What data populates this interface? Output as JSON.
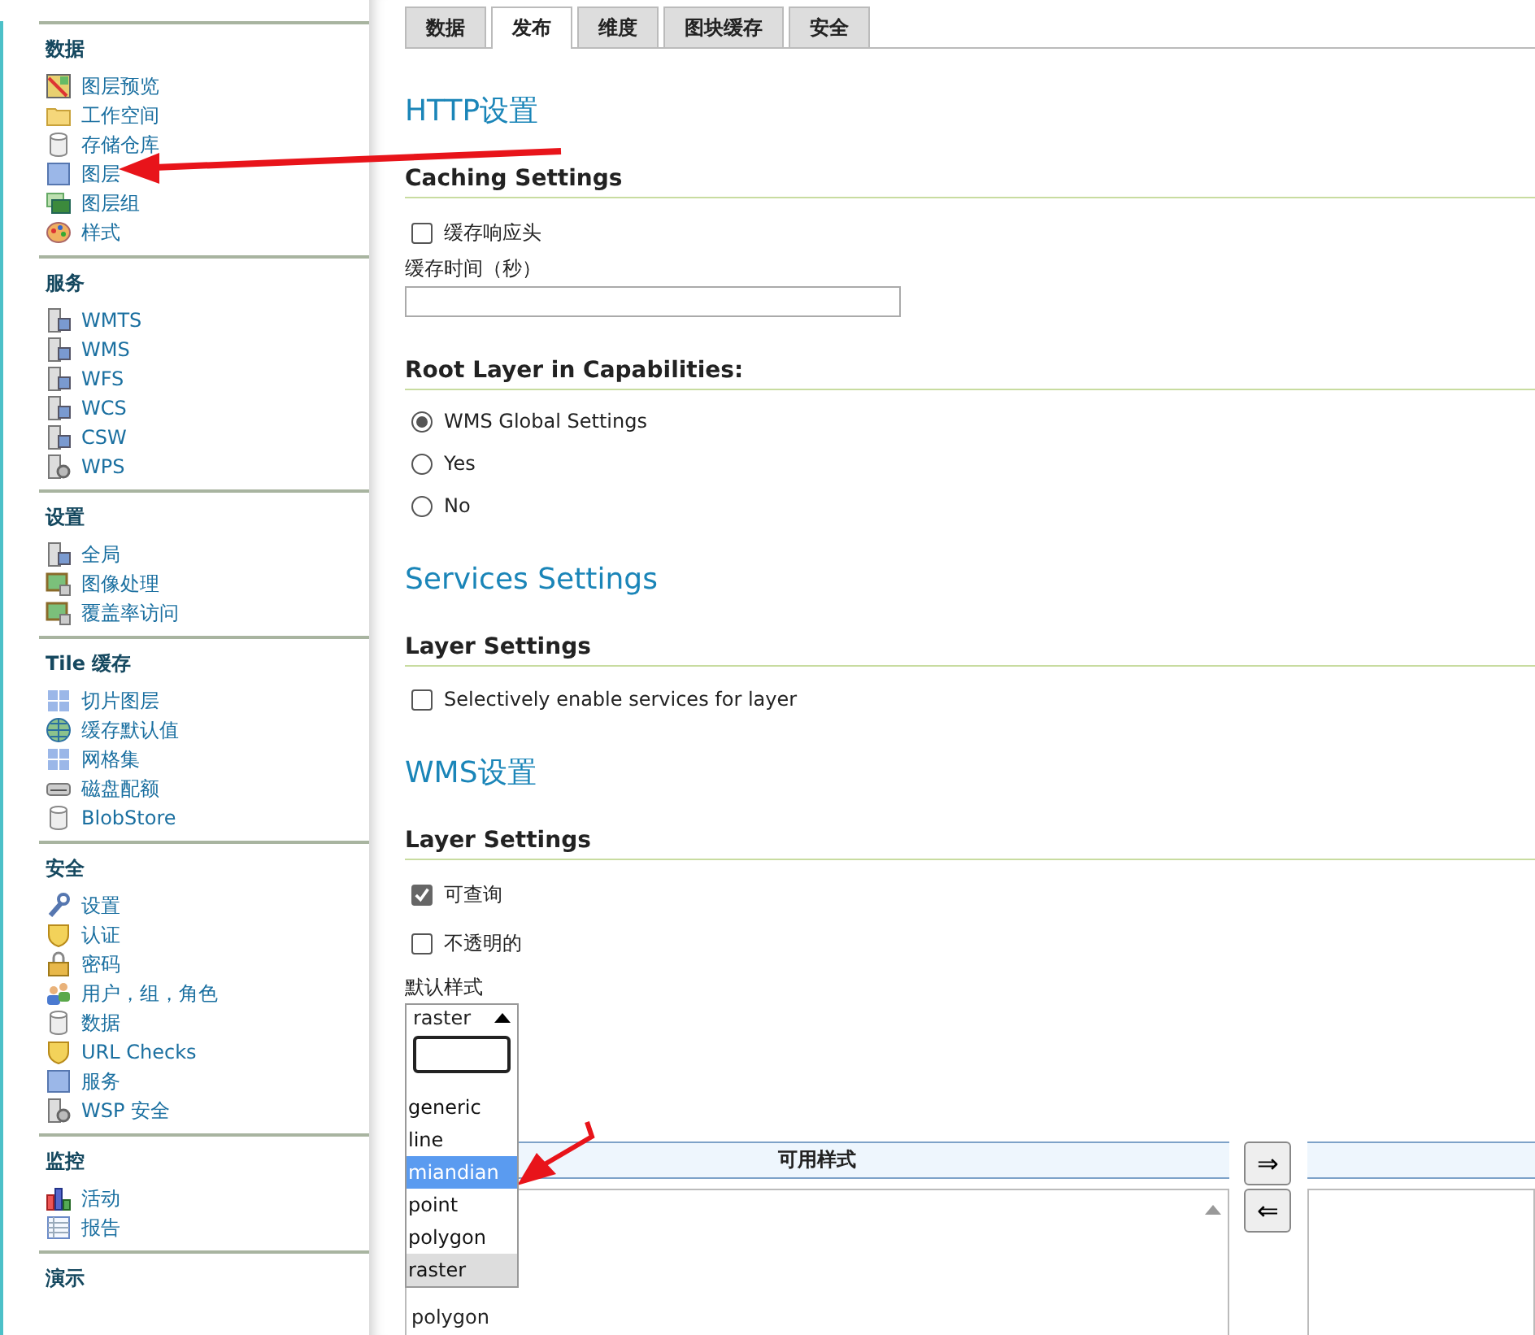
{
  "sidebar": {
    "sections": [
      {
        "title": "数据",
        "items": [
          {
            "label": "图层预览",
            "kind": "map"
          },
          {
            "label": "工作空间",
            "kind": "folder"
          },
          {
            "label": "存储仓库",
            "kind": "cylinder"
          },
          {
            "label": "图层",
            "kind": "square"
          },
          {
            "label": "图层组",
            "kind": "layers"
          },
          {
            "label": "样式",
            "kind": "palette"
          }
        ]
      },
      {
        "title": "服务",
        "items": [
          {
            "label": "WMTS",
            "kind": "server"
          },
          {
            "label": "WMS",
            "kind": "server"
          },
          {
            "label": "WFS",
            "kind": "server"
          },
          {
            "label": "WCS",
            "kind": "server"
          },
          {
            "label": "CSW",
            "kind": "server"
          },
          {
            "label": "WPS",
            "kind": "gear"
          }
        ]
      },
      {
        "title": "设置",
        "items": [
          {
            "label": "全局",
            "kind": "server"
          },
          {
            "label": "图像处理",
            "kind": "image"
          },
          {
            "label": "覆盖率访问",
            "kind": "image"
          }
        ]
      },
      {
        "title": "Tile 缓存",
        "items": [
          {
            "label": "切片图层",
            "kind": "grid"
          },
          {
            "label": "缓存默认值",
            "kind": "globe"
          },
          {
            "label": "网格集",
            "kind": "grid"
          },
          {
            "label": "磁盘配额",
            "kind": "disk"
          },
          {
            "label": "BlobStore",
            "kind": "cylinder"
          }
        ]
      },
      {
        "title": "安全",
        "items": [
          {
            "label": "设置",
            "kind": "wrench"
          },
          {
            "label": "认证",
            "kind": "shield"
          },
          {
            "label": "密码",
            "kind": "lock"
          },
          {
            "label": "用户，组，角色",
            "kind": "users"
          },
          {
            "label": "数据",
            "kind": "cylinder"
          },
          {
            "label": "URL Checks",
            "kind": "shield"
          },
          {
            "label": "服务",
            "kind": "square"
          },
          {
            "label": "WSP 安全",
            "kind": "gear"
          }
        ]
      },
      {
        "title": "监控",
        "items": [
          {
            "label": "活动",
            "kind": "chart"
          },
          {
            "label": "报告",
            "kind": "table"
          }
        ]
      },
      {
        "title": "演示"
      }
    ]
  },
  "tabs": [
    {
      "label": "数据",
      "selected": false
    },
    {
      "label": "发布",
      "selected": true
    },
    {
      "label": "维度",
      "selected": false
    },
    {
      "label": "图块缓存",
      "selected": false
    },
    {
      "label": "安全",
      "selected": false
    }
  ],
  "content": [
    {
      "kind": "heading",
      "text": "HTTP设置"
    },
    {
      "kind": "subheading",
      "text": "Caching Settings"
    },
    {
      "kind": "checkbox",
      "label": "缓存响应头",
      "checked": false
    },
    {
      "kind": "field",
      "label": "缓存时间（秒）"
    },
    {
      "kind": "subheading",
      "text": "Root Layer in Capabilities:"
    },
    {
      "kind": "radio",
      "label": "WMS Global Settings",
      "checked": true
    },
    {
      "kind": "radio",
      "label": "Yes",
      "checked": false
    },
    {
      "kind": "radio",
      "label": "No",
      "checked": false
    },
    {
      "kind": "heading",
      "text": "Services Settings"
    },
    {
      "kind": "subheading",
      "text": "Layer Settings"
    },
    {
      "kind": "checkbox",
      "label": "Selectively enable services for layer",
      "checked": false
    },
    {
      "kind": "heading",
      "text": "WMS设置"
    },
    {
      "kind": "subheading",
      "text": "Layer Settings"
    },
    {
      "kind": "checkbox",
      "label": "可查询",
      "checked": true
    },
    {
      "kind": "checkbox",
      "label": "不透明的",
      "checked": false
    },
    {
      "kind": "select",
      "label": "默认样式",
      "value": "raster",
      "open": true,
      "options": [
        {
          "label": "generic",
          "selected": false,
          "highlighted": false
        },
        {
          "label": "line",
          "selected": false,
          "highlighted": false
        },
        {
          "label": "miandian",
          "selected": false,
          "highlighted": true
        },
        {
          "label": "point",
          "selected": false,
          "highlighted": false
        },
        {
          "label": "polygon",
          "selected": false,
          "highlighted": false
        },
        {
          "label": "raster",
          "selected": true,
          "highlighted": false
        }
      ]
    },
    {
      "kind": "duallist",
      "available_header": "可用样式",
      "available_items": [
        "polygon"
      ],
      "buttons": [
        "⇒",
        "⇐"
      ]
    }
  ]
}
